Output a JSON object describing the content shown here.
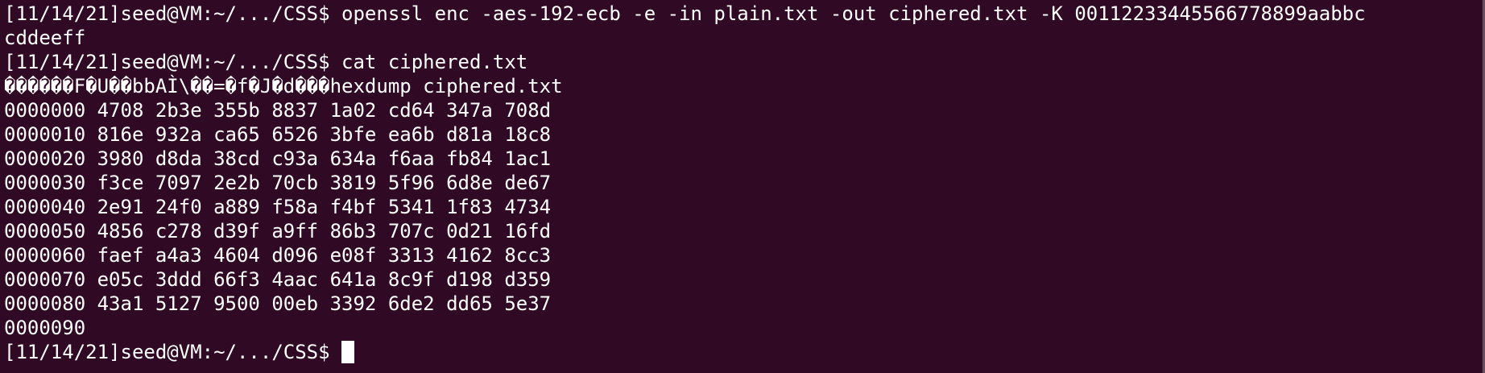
{
  "terminal": {
    "colors": {
      "background": "#300a24",
      "foreground": "#ffffff"
    },
    "lines": [
      "[11/14/21]seed@VM:~/.../CSS$ openssl enc -aes-192-ecb -e -in plain.txt -out ciphered.txt -K 00112233445566778899aabbc",
      "cddeeff",
      "[11/14/21]seed@VM:~/.../CSS$ cat ciphered.txt",
      "������F�U��bbAÌ\\��=�f�J�d���hexdump ciphered.txt",
      "0000000 4708 2b3e 355b 8837 1a02 cd64 347a 708d",
      "0000010 816e 932a ca65 6526 3bfe ea6b d81a 18c8",
      "0000020 3980 d8da 38cd c93a 634a f6aa fb84 1ac1",
      "0000030 f3ce 7097 2e2b 70cb 3819 5f96 6d8e de67",
      "0000040 2e91 24f0 a889 f58a f4bf 5341 1f83 4734",
      "0000050 4856 c278 d39f a9ff 86b3 707c 0d21 16fd",
      "0000060 faef a4a3 4604 d096 e08f 3313 4162 8cc3",
      "0000070 e05c 3ddd 66f3 4aac 641a 8c9f d198 d359",
      "0000080 43a1 5127 9500 00eb 3392 6de2 dd65 5e37",
      "0000090"
    ],
    "current_prompt": "[11/14/21]seed@VM:~/.../CSS$"
  }
}
